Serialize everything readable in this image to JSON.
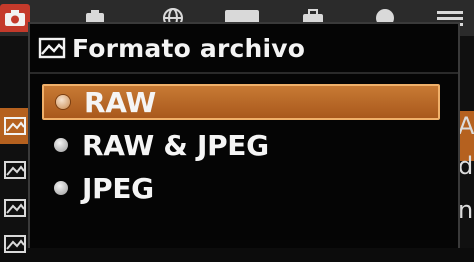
{
  "dialog": {
    "title": "Formato archivo",
    "title_icon": "image-file-icon",
    "options": [
      {
        "label": "RAW",
        "selected": true
      },
      {
        "label": "RAW & JPEG",
        "selected": false
      },
      {
        "label": "JPEG",
        "selected": false
      }
    ]
  },
  "background_menu": {
    "tabs": [
      "camera-icon",
      "shooting-icon",
      "play-icon",
      "globe-icon",
      "card-icon",
      "toolbox-icon",
      "menu-icon"
    ],
    "active_tab": "camera-icon",
    "side_icons": [
      "image-file-icon",
      "image-file-icon",
      "image-file-icon",
      "image-file-icon"
    ],
    "right_edge_letters": [
      "A",
      "d",
      "n"
    ]
  },
  "colors": {
    "highlight": "#b5611f",
    "active_tab": "#c43a2b",
    "dialog_bg": "#050505"
  }
}
